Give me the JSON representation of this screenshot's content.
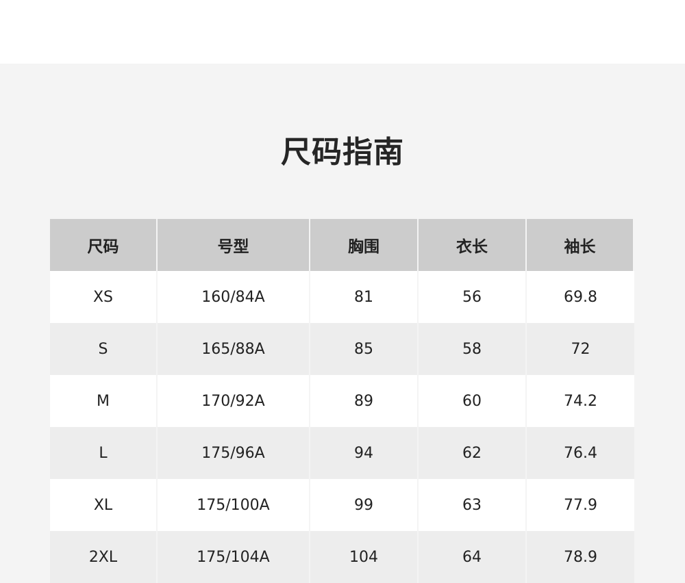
{
  "page": {
    "title": "尺码指南"
  },
  "table": {
    "headers": [
      "尺码",
      "号型",
      "胸围",
      "衣长",
      "袖长"
    ],
    "rows": [
      [
        "XS",
        "160/84A",
        "81",
        "56",
        "69.8"
      ],
      [
        "S",
        "165/88A",
        "85",
        "58",
        "72"
      ],
      [
        "M",
        "170/92A",
        "89",
        "60",
        "74.2"
      ],
      [
        "L",
        "175/96A",
        "94",
        "62",
        "76.4"
      ],
      [
        "XL",
        "175/100A",
        "99",
        "63",
        "77.9"
      ],
      [
        "2XL",
        "175/104A",
        "104",
        "64",
        "78.9"
      ]
    ]
  },
  "colors": {
    "header_bg": "#cccccc",
    "row_white": "#ffffff",
    "row_gray": "#ededed",
    "page_bg": "#f4f4f4"
  }
}
